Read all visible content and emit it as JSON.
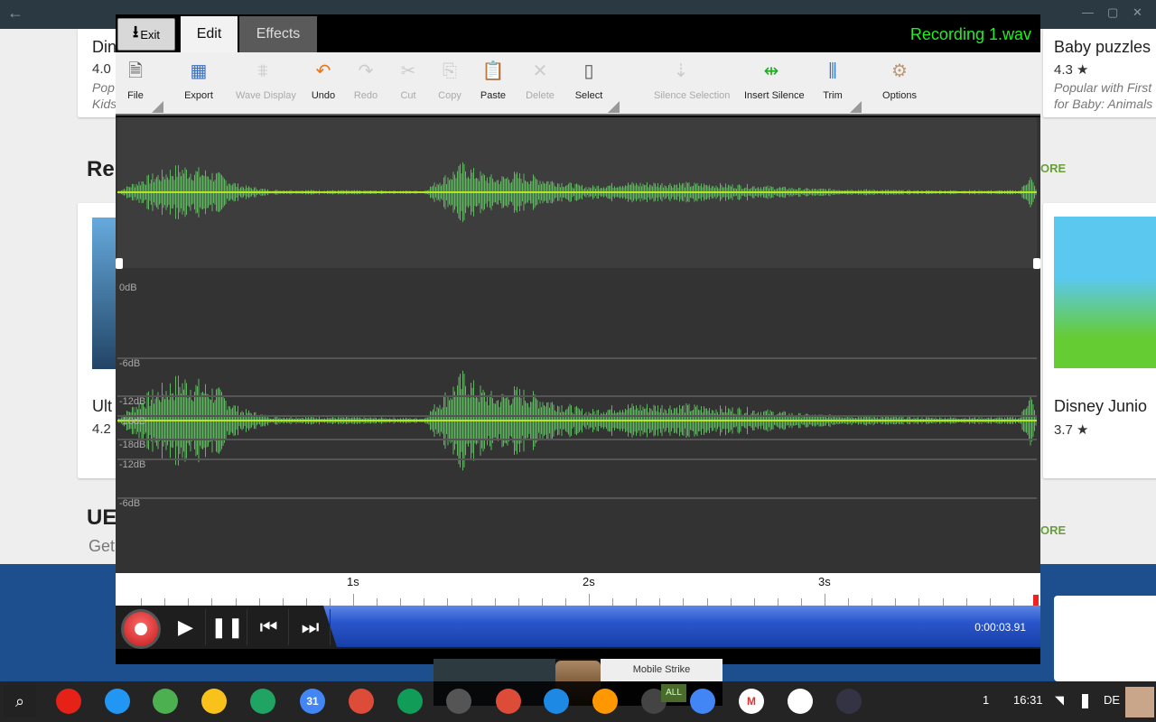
{
  "background": {
    "cards_top": [
      {
        "title": "Din",
        "rating": "4.0",
        "desc": "Pop\nKids"
      },
      {
        "title": "Baby puzzles",
        "rating": "4.3 ★",
        "desc": "Popular with First\nfor Baby: Animals"
      }
    ],
    "section1": "Re",
    "more": "ORE",
    "cards_mid": [
      {
        "title": "Ult",
        "rating": "4.2"
      },
      {
        "title": "Disney Junio",
        "rating": "3.7 ★"
      }
    ],
    "section2": "UE",
    "section2_sub": "Get"
  },
  "app": {
    "exit_label": "Exit",
    "tabs": [
      {
        "label": "Edit",
        "active": true
      },
      {
        "label": "Effects",
        "active": false
      }
    ],
    "title": "Recording 1.wav",
    "toolbar": [
      {
        "label": "File",
        "icon": "file-icon",
        "enabled": true
      },
      {
        "label": "Export",
        "icon": "export-icon",
        "enabled": true
      },
      {
        "label": "Wave Display",
        "icon": "wave-display-icon",
        "enabled": false
      },
      {
        "label": "Undo",
        "icon": "undo-icon",
        "enabled": true
      },
      {
        "label": "Redo",
        "icon": "redo-icon",
        "enabled": false
      },
      {
        "label": "Cut",
        "icon": "cut-icon",
        "enabled": false
      },
      {
        "label": "Copy",
        "icon": "copy-icon",
        "enabled": false
      },
      {
        "label": "Paste",
        "icon": "paste-icon",
        "enabled": true
      },
      {
        "label": "Delete",
        "icon": "delete-icon",
        "enabled": false
      },
      {
        "label": "Select",
        "icon": "select-icon",
        "enabled": true
      },
      {
        "label": "Silence Selection",
        "icon": "silence-selection-icon",
        "enabled": false
      },
      {
        "label": "Insert Silence",
        "icon": "insert-silence-icon",
        "enabled": true
      },
      {
        "label": "Trim",
        "icon": "trim-icon",
        "enabled": true
      },
      {
        "label": "Options",
        "icon": "options-icon",
        "enabled": true
      }
    ],
    "db_labels": [
      "0dB",
      "-6dB",
      "-12dB",
      "-18dB",
      "-18dB",
      "-12dB",
      "-6dB",
      "0dB"
    ],
    "ruler_labels": [
      "1s",
      "2s",
      "3s"
    ],
    "time": "0:00:03.91",
    "wave_color": "#5cb85c",
    "center_line_color": "#b5e61d"
  },
  "notification": {
    "title": "Mobile Strike",
    "button": "ALL"
  },
  "taskbar": {
    "apps": [
      "YouTube",
      "Files",
      "Chrome",
      "Keep",
      "Drive",
      "Calendar",
      "Google+",
      "Hangouts",
      "Activity",
      "Google+",
      "Books",
      "Music",
      "Google",
      "Docs",
      "Gmail",
      "Play Store",
      "Wave Editor"
    ],
    "calendar_day": "31",
    "badge": "1",
    "clock": "16:31",
    "lang": "DE"
  }
}
